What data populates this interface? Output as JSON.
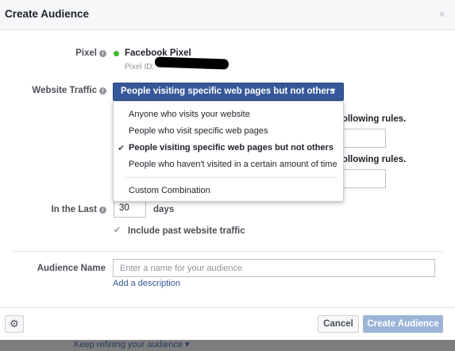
{
  "dialog": {
    "title": "Create Audience",
    "close_symbol": "×"
  },
  "pixel": {
    "label": "Pixel",
    "name": "Facebook Pixel",
    "id_label": "Pixel ID:"
  },
  "website_traffic": {
    "label": "Website Traffic",
    "selected": "People visiting specific web pages but not others",
    "options": [
      "Anyone who visits your website",
      "People who visit specific web pages",
      "People visiting specific web pages but not others",
      "People who haven't visited in a certain amount of time",
      "Custom Combination"
    ]
  },
  "rules": {
    "text_1": "following rules.",
    "text_2": "following rules."
  },
  "in_the_last": {
    "label": "In the Last",
    "value": "30",
    "unit": "days"
  },
  "include_past": {
    "label": "Include past website traffic",
    "checked": true
  },
  "audience_name": {
    "label": "Audience Name",
    "placeholder": "Enter a name for your audience",
    "add_description": "Add a description"
  },
  "footer": {
    "cancel_label": "Cancel",
    "create_label": "Create Audience"
  },
  "background": {
    "refine_text": "Keep refining your audience ▾"
  },
  "colors": {
    "accent": "#365899",
    "pixel_status": "#42b72a",
    "create_disabled": "#9cb4d8"
  }
}
